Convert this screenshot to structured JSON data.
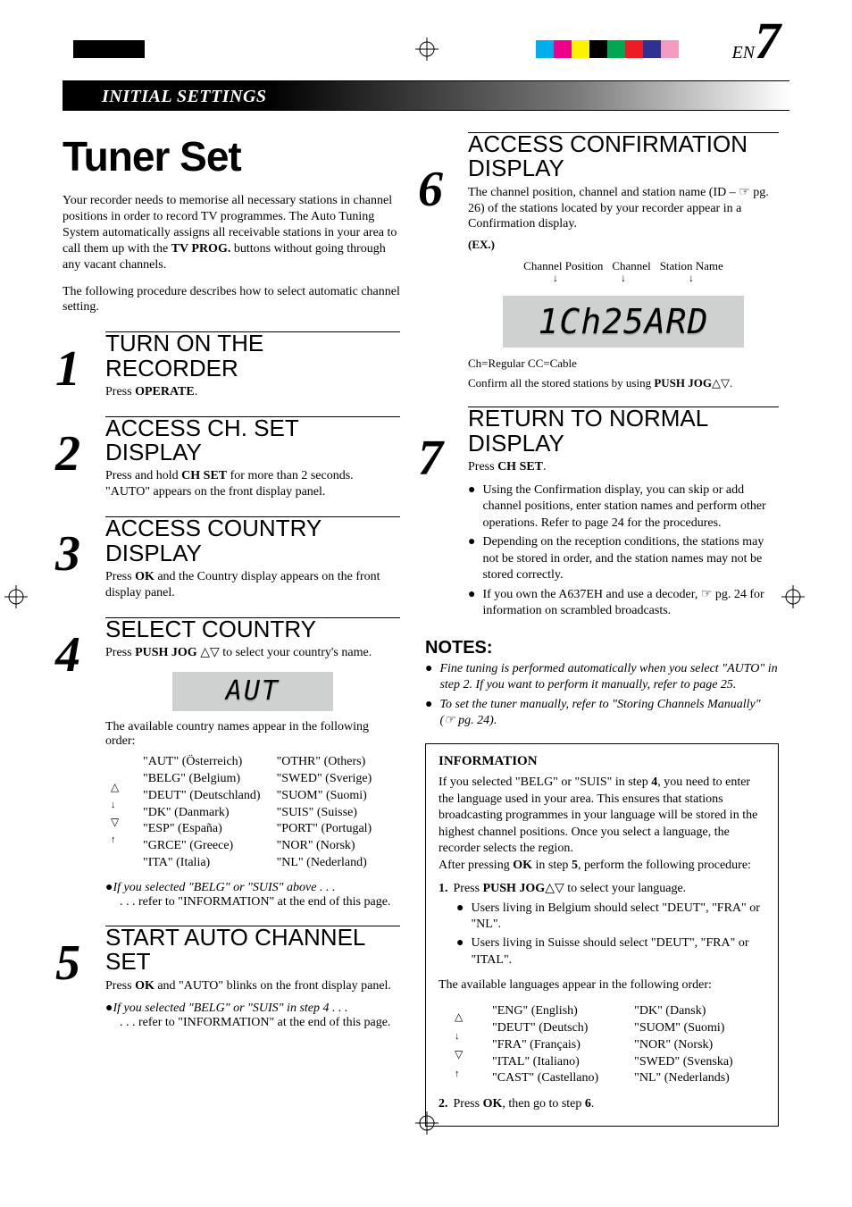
{
  "header": {
    "section": "INITIAL SETTINGS",
    "lang_code": "EN",
    "page_number": "7"
  },
  "left": {
    "title": "Tuner Set",
    "intro1": "Your recorder needs to memorise all necessary stations in channel positions in order to record TV programmes. The Auto Tuning System automatically assigns all receivable stations in your area to call them up with the ",
    "intro1_bold": "TV PROG.",
    "intro1_tail": " buttons without going through any vacant channels.",
    "intro2": "The following procedure describes how to select automatic channel setting.",
    "steps": {
      "s1": {
        "num": "1",
        "title": "TURN ON THE RECORDER",
        "body_pre": "Press ",
        "body_bold": "OPERATE",
        "body_post": "."
      },
      "s2": {
        "num": "2",
        "title": "ACCESS CH. SET DISPLAY",
        "body_pre": "Press and hold ",
        "body_bold": "CH SET",
        "body_post": " for more than 2 seconds. \"AUTO\" appears on the front display panel."
      },
      "s3": {
        "num": "3",
        "title": "ACCESS COUNTRY DISPLAY",
        "body_pre": "Press ",
        "body_bold": "OK",
        "body_post": " and the Country display appears on the front display panel."
      },
      "s4": {
        "num": "4",
        "title": "SELECT COUNTRY",
        "body_pre": "Press ",
        "body_bold": "PUSH JOG",
        "body_post": " △▽ to select your country's name.",
        "lcd": "AUT",
        "order_intro": "The available country names appear in the following order:",
        "col1": [
          "\"AUT\" (Österreich)",
          "\"BELG\" (Belgium)",
          "\"DEUT\" (Deutschland)",
          "\"DK\" (Danmark)",
          "\"ESP\" (España)",
          "\"GRCE\" (Greece)",
          "\"ITA\" (Italia)"
        ],
        "col2": [
          "\"OTHR\" (Others)",
          "\"SWED\" (Sverige)",
          "\"SUOM\" (Suomi)",
          "\"SUIS\" (Suisse)",
          "\"PORT\" (Portugal)",
          "\"NOR\" (Norsk)",
          "\"NL\" (Nederland)"
        ],
        "note_it": "If you selected \"BELG\" or \"SUIS\" above . . .",
        "note_plain": ". . . refer to \"INFORMATION\" at the end of this page."
      },
      "s5": {
        "num": "5",
        "title": "START AUTO CHANNEL SET",
        "body_pre": "Press ",
        "body_bold": "OK",
        "body_post": " and \"AUTO\" blinks on the front display panel.",
        "note_it": "If you selected \"BELG\" or \"SUIS\" in step 4 . . .",
        "note_plain": ". . . refer to \"INFORMATION\" at the end of this page."
      }
    }
  },
  "right": {
    "steps": {
      "s6": {
        "num": "6",
        "title": "ACCESS CONFIRMATION DISPLAY",
        "body": "The channel position, channel and station name (ID – ☞ pg. 26) of the stations located by your recorder appear in a Confirmation display.",
        "ex": "(EX.)",
        "labels": {
          "cp": "Channel Position",
          "ch": "Channel",
          "sn": "Station Name"
        },
        "lcd": "1Ch25ARD",
        "caption1": "Ch=Regular  CC=Cable",
        "caption2_pre": "Confirm all the stored stations by using ",
        "caption2_bold": "PUSH JOG",
        "caption2_post": "△▽."
      },
      "s7": {
        "num": "7",
        "title": "RETURN TO NORMAL DISPLAY",
        "body_pre": "Press ",
        "body_bold": "CH SET",
        "body_post": ".",
        "bullets": [
          "Using the Confirmation display, you can skip or add channel positions, enter station names and perform other operations. Refer to page 24 for the procedures.",
          "Depending on the reception conditions, the stations may not be stored in order, and the station names may not be stored correctly.",
          "If you own the A637EH and use a decoder, ☞ pg. 24 for information on scrambled broadcasts."
        ]
      }
    },
    "notes": {
      "heading": "NOTES:",
      "items": [
        "Fine tuning is performed automatically when you select \"AUTO\" in step 2. If you want to perform it manually, refer to page 25.",
        "To set the tuner manually, refer to \"Storing Channels Manually\" (☞ pg. 24)."
      ]
    },
    "info": {
      "heading": "INFORMATION",
      "p1_a": "If you selected \"BELG\" or \"SUIS\" in step ",
      "p1_b": "4",
      "p1_c": ", you need to enter the language used in your area. This ensures that stations broadcasting programmes in your language will be stored in the highest channel positions. Once you select a language, the recorder selects the region.",
      "p2_a": "After pressing ",
      "p2_b": "OK",
      "p2_c": " in step ",
      "p2_d": "5",
      "p2_e": ", perform the following procedure:",
      "step1_pre": "Press ",
      "step1_bold": "PUSH JOG",
      "step1_post": "△▽ to select your language.",
      "sub": [
        "Users living in Belgium should select \"DEUT\", \"FRA\" or \"NL\".",
        "Users living in Suisse should select \"DEUT\", \"FRA\" or \"ITAL\"."
      ],
      "lang_intro": "The available languages appear in the following order:",
      "lang_col1": [
        "\"ENG\" (English)",
        "\"DEUT\" (Deutsch)",
        "\"FRA\" (Français)",
        "\"ITAL\" (Italiano)",
        "\"CAST\" (Castellano)"
      ],
      "lang_col2": [
        "\"DK\" (Dansk)",
        "\"SUOM\" (Suomi)",
        "\"NOR\" (Norsk)",
        "\"SWED\" (Svenska)",
        "\"NL\" (Nederlands)"
      ],
      "step2_pre": "Press ",
      "step2_bold": "OK",
      "step2_post": ", then go to step ",
      "step2_bold2": "6",
      "step2_tail": "."
    }
  },
  "reg_colors_left": [
    "#000",
    "#000",
    "#000",
    "#000"
  ],
  "reg_colors_right": [
    "#00aeef",
    "#ec008c",
    "#fff200",
    "#000",
    "#00a651",
    "#ed1c24",
    "#2e3192",
    "#f49ac1"
  ]
}
